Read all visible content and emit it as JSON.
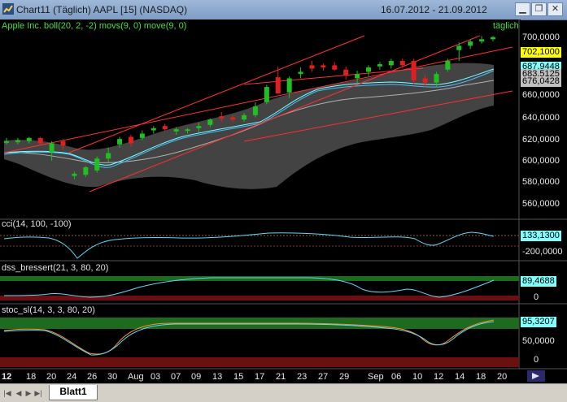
{
  "window": {
    "title": "Chart11 (Täglich)  AAPL [15] (NASDAQ)",
    "date_range": "16.07.2012 - 21.09.2012"
  },
  "main_panel": {
    "label": "Apple Inc. boll(20, 2, -2) movs(9, 0) move(9, 0)",
    "period": "täglich",
    "y_ticks": [
      "700,0000",
      "660,0000",
      "640,0000",
      "620,0000",
      "600,0000",
      "580,0000",
      "560,0000"
    ],
    "tags": [
      {
        "value": "702,1000",
        "color": "#ffff00"
      },
      {
        "value": "687,9448",
        "color": "#80ffff"
      },
      {
        "value": "683,5125",
        "color": "#c0c0c0"
      },
      {
        "value": "676,0428",
        "color": "#c0c0c0"
      }
    ]
  },
  "cci_panel": {
    "label": "cci(14, 100, -100)",
    "y_ticks": [
      "-200,0000"
    ],
    "tag": {
      "value": "133,1300",
      "color": "#80ffff"
    }
  },
  "dss_panel": {
    "label": "dss_bressert(21, 3, 80, 20)",
    "y_ticks": [
      "0"
    ],
    "tag": {
      "value": "89,4688",
      "color": "#80ffff"
    }
  },
  "stoc_panel": {
    "label": "stoc_sl(14, 3, 3, 80, 20)",
    "y_ticks": [
      "50,0000",
      "0"
    ],
    "tag": {
      "value": "95,3207",
      "color": "#80ffff"
    }
  },
  "x_axis": {
    "labels": [
      "12",
      "18",
      "20",
      "24",
      "26",
      "30",
      "Aug",
      "03",
      "07",
      "09",
      "13",
      "15",
      "17",
      "21",
      "23",
      "27",
      "29",
      "Sep",
      "06",
      "10",
      "12",
      "14",
      "18",
      "20"
    ]
  },
  "chart_data": {
    "type": "candlestick",
    "symbol": "AAPL",
    "exchange": "NASDAQ",
    "y_range": [
      540,
      710
    ],
    "candles": [
      {
        "o": 606,
        "h": 609,
        "l": 603,
        "c": 605,
        "dir": "up"
      },
      {
        "o": 605,
        "h": 609,
        "l": 603,
        "c": 607,
        "dir": "up"
      },
      {
        "o": 606,
        "h": 610,
        "l": 604,
        "c": 609,
        "dir": "up"
      },
      {
        "o": 609,
        "h": 610,
        "l": 603,
        "c": 604,
        "dir": "down"
      },
      {
        "o": 604,
        "h": 606,
        "l": 588,
        "c": 596,
        "dir": "up"
      },
      {
        "o": 606,
        "h": 608,
        "l": 598,
        "c": 602,
        "dir": "down"
      },
      {
        "o": 574,
        "h": 578,
        "l": 571,
        "c": 576,
        "dir": "up"
      },
      {
        "o": 575,
        "h": 583,
        "l": 573,
        "c": 582,
        "dir": "up"
      },
      {
        "o": 579,
        "h": 592,
        "l": 577,
        "c": 590,
        "dir": "up"
      },
      {
        "o": 590,
        "h": 600,
        "l": 587,
        "c": 595,
        "dir": "up"
      },
      {
        "o": 603,
        "h": 610,
        "l": 600,
        "c": 608,
        "dir": "up"
      },
      {
        "o": 610,
        "h": 612,
        "l": 601,
        "c": 604,
        "dir": "down"
      },
      {
        "o": 609,
        "h": 616,
        "l": 607,
        "c": 613,
        "dir": "up"
      },
      {
        "o": 616,
        "h": 620,
        "l": 613,
        "c": 618,
        "dir": "up"
      },
      {
        "o": 620,
        "h": 622,
        "l": 615,
        "c": 617,
        "dir": "down"
      },
      {
        "o": 617,
        "h": 619,
        "l": 612,
        "c": 615,
        "dir": "up"
      },
      {
        "o": 616,
        "h": 618,
        "l": 613,
        "c": 617,
        "dir": "up"
      },
      {
        "o": 620,
        "h": 623,
        "l": 614,
        "c": 618,
        "dir": "up"
      },
      {
        "o": 621,
        "h": 627,
        "l": 619,
        "c": 626,
        "dir": "up"
      },
      {
        "o": 629,
        "h": 633,
        "l": 624,
        "c": 627,
        "dir": "down"
      },
      {
        "o": 626,
        "h": 630,
        "l": 624,
        "c": 628,
        "dir": "down"
      },
      {
        "o": 626,
        "h": 632,
        "l": 624,
        "c": 630,
        "dir": "up"
      },
      {
        "o": 630,
        "h": 642,
        "l": 628,
        "c": 638,
        "dir": "up"
      },
      {
        "o": 642,
        "h": 658,
        "l": 640,
        "c": 656,
        "dir": "up"
      },
      {
        "o": 665,
        "h": 675,
        "l": 655,
        "c": 650,
        "dir": "down"
      },
      {
        "o": 651,
        "h": 666,
        "l": 646,
        "c": 664,
        "dir": "up"
      },
      {
        "o": 668,
        "h": 674,
        "l": 664,
        "c": 670,
        "dir": "up"
      },
      {
        "o": 676,
        "h": 680,
        "l": 670,
        "c": 673,
        "dir": "down"
      },
      {
        "o": 676,
        "h": 678,
        "l": 671,
        "c": 674,
        "dir": "down"
      },
      {
        "o": 676,
        "h": 679,
        "l": 671,
        "c": 672,
        "dir": "down"
      },
      {
        "o": 672,
        "h": 675,
        "l": 663,
        "c": 667,
        "dir": "down"
      },
      {
        "o": 668,
        "h": 671,
        "l": 659,
        "c": 664,
        "dir": "up"
      },
      {
        "o": 670,
        "h": 676,
        "l": 666,
        "c": 674,
        "dir": "up"
      },
      {
        "o": 675,
        "h": 679,
        "l": 672,
        "c": 677,
        "dir": "up"
      },
      {
        "o": 676,
        "h": 682,
        "l": 673,
        "c": 680,
        "dir": "up"
      },
      {
        "o": 680,
        "h": 682,
        "l": 674,
        "c": 676,
        "dir": "down"
      },
      {
        "o": 680,
        "h": 682,
        "l": 658,
        "c": 662,
        "dir": "down"
      },
      {
        "o": 664,
        "h": 667,
        "l": 656,
        "c": 660,
        "dir": "down"
      },
      {
        "o": 660,
        "h": 670,
        "l": 656,
        "c": 668,
        "dir": "up"
      },
      {
        "o": 672,
        "h": 682,
        "l": 670,
        "c": 680,
        "dir": "up"
      },
      {
        "o": 690,
        "h": 697,
        "l": 680,
        "c": 694,
        "dir": "up"
      },
      {
        "o": 694,
        "h": 700,
        "l": 691,
        "c": 698,
        "dir": "up"
      },
      {
        "o": 698,
        "h": 703,
        "l": 696,
        "c": 700,
        "dir": "up"
      },
      {
        "o": 700,
        "h": 703,
        "l": 698,
        "c": 702,
        "dir": "up"
      }
    ]
  },
  "bottom_bar": {
    "sheet_tab": "Blatt1"
  }
}
